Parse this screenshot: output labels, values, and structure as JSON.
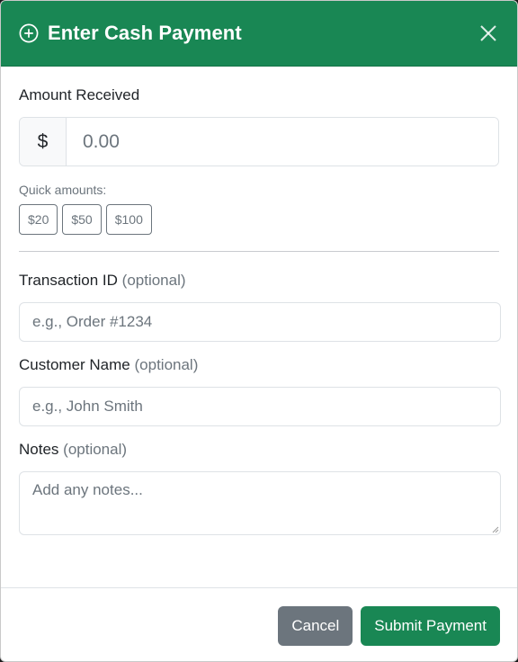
{
  "modal": {
    "title": "Enter Cash Payment",
    "header_icon": "plus-circle-icon",
    "close_icon": "close-icon"
  },
  "amount": {
    "label": "Amount Received",
    "prefix": "$",
    "placeholder": "0.00",
    "value": ""
  },
  "quick_amounts": {
    "label": "Quick amounts:",
    "options": [
      "$20",
      "$50",
      "$100"
    ]
  },
  "transaction_id": {
    "label": "Transaction ID",
    "optional": "(optional)",
    "placeholder": "e.g., Order #1234",
    "value": ""
  },
  "customer_name": {
    "label": "Customer Name",
    "optional": "(optional)",
    "placeholder": "e.g., John Smith",
    "value": ""
  },
  "notes": {
    "label": "Notes",
    "optional": "(optional)",
    "placeholder": "Add any notes...",
    "value": ""
  },
  "footer": {
    "cancel_label": "Cancel",
    "submit_label": "Submit Payment"
  },
  "colors": {
    "header_bg": "#198754",
    "submit_bg": "#198754",
    "cancel_bg": "#6c757d"
  }
}
